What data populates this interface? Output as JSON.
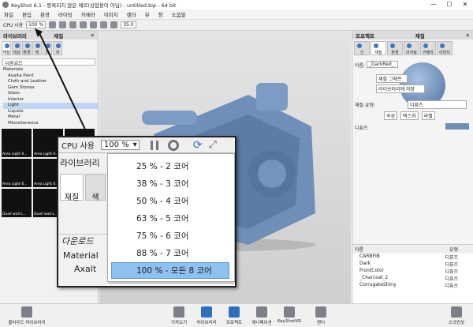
{
  "window": {
    "title": "KeyShot 6.1 - 등록되지 않은 메르(상업용이 아님) - untitled.bip - 64 bit",
    "min": "—",
    "max": "☐",
    "close": "✕"
  },
  "menu": [
    "파일",
    "편집",
    "환경",
    "라이팅",
    "카메라",
    "이미지",
    "렌더",
    "뷰",
    "창",
    "도움말"
  ],
  "toolbar": {
    "cpu_label": "CPU 사용",
    "cpu_value": "100 %",
    "num_value": "35.0"
  },
  "left_panel": {
    "title": "라이브러리",
    "sub_title": "재질",
    "tabs": [
      "재질",
      "색상",
      "환경",
      "텍",
      "마",
      "저"
    ],
    "search": "다운로드",
    "tree": [
      "Materials",
      "Axalta Paint",
      "Cloth and Leather",
      "Gem Stones",
      "Glass",
      "Interior",
      "Light",
      "Liquids",
      "Metal",
      "Miscellaneous"
    ],
    "thumbs": [
      "Area Light 6...",
      "Area Light 6...",
      "Area Light 6...",
      "Area Light 6...",
      "Area Light 6...",
      "Downut fla...",
      "Duell wall L...",
      "Duell wall L...",
      "Duell wall L...",
      "",
      "",
      ""
    ]
  },
  "right_panel": {
    "title": "프로젝트",
    "sub_title": "재질",
    "tabs": [
      "신",
      "재질",
      "환경",
      "라이팅",
      "카메라",
      "이미지"
    ],
    "name_label": "이름:",
    "name_value": "_DarkRed_",
    "btn_graph": "재질 그래프",
    "btn_save": "라이브러리에 저장",
    "type_label": "재질 유형:",
    "type_value": "디퓨즈",
    "prop_tabs": [
      "속성",
      "텍스처",
      "라벨"
    ],
    "diffuse_label": "디퓨즈",
    "list_header": [
      "이름",
      "유형"
    ],
    "list": [
      {
        "name": "CARBFIB",
        "type": "디퓨즈"
      },
      {
        "name": "Dark",
        "type": "디퓨즈"
      },
      {
        "name": "FrontColor",
        "type": "디퓨즈"
      },
      {
        "name": "_Charcoal_2",
        "type": "디퓨즈"
      },
      {
        "name": "CorrugateShiny",
        "type": "디퓨즈"
      }
    ]
  },
  "bottom": {
    "left": "클라우드 라이브러리",
    "items": [
      "가져오기",
      "라이브러리",
      "프로젝트",
      "애니메이션",
      "KeyShotVR",
      "렌더"
    ],
    "right": "스크린샷"
  },
  "zoom": {
    "cpu_label": "CPU 사용",
    "cpu_value": "100 %",
    "library_label": "라이브러리",
    "tab_mat": "재질",
    "tab_col": "색",
    "search": "다운로드",
    "tree_root": "Material",
    "tree_child": "Axalt",
    "options": [
      "25 % - 2 코어",
      "38 % - 3 코어",
      "50 % - 4 코어",
      "63 % - 5 코어",
      "75 % - 6 코어",
      "88 % - 7 코어",
      "100 % - 모든 8 코어"
    ]
  },
  "colors": {
    "selected_row": "#8ec1ef",
    "accent": "#3b76c4",
    "material": "#6f8fb9"
  }
}
